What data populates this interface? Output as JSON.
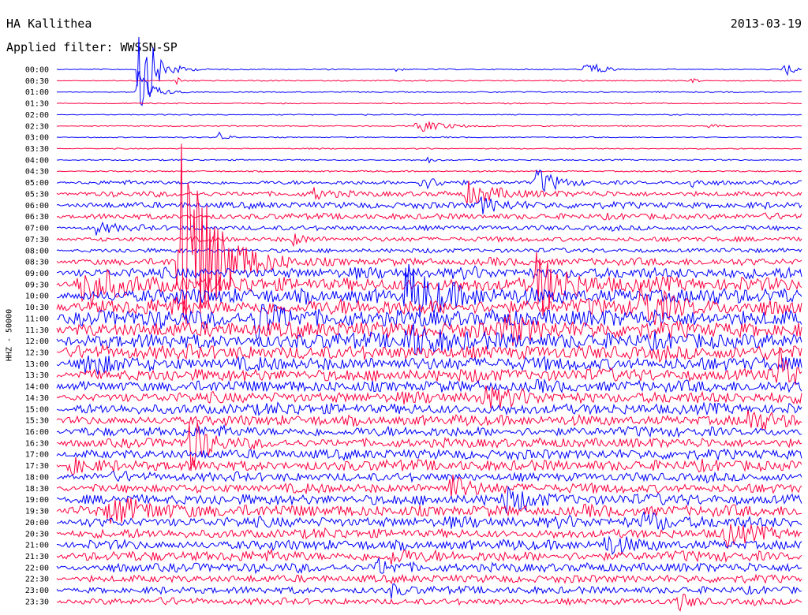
{
  "chart_data": {
    "type": "helicorder",
    "title": "HA Kallithea",
    "date": "2013-03-19",
    "subtitle": "Applied filter: WWSSN-SP",
    "ylabel": "HHZ - 50000",
    "row_labels": [
      "00:00",
      "00:30",
      "01:00",
      "01:30",
      "02:00",
      "02:30",
      "03:00",
      "03:30",
      "04:00",
      "04:30",
      "05:00",
      "05:30",
      "06:00",
      "06:30",
      "07:00",
      "07:30",
      "08:00",
      "08:30",
      "09:00",
      "09:30",
      "10:00",
      "10:30",
      "11:00",
      "11:30",
      "12:00",
      "12:30",
      "13:00",
      "13:30",
      "14:00",
      "14:30",
      "15:00",
      "15:30",
      "16:00",
      "16:30",
      "17:00",
      "17:30",
      "18:00",
      "18:30",
      "19:00",
      "19:30",
      "20:00",
      "20:30",
      "21:00",
      "21:30",
      "22:00",
      "22:30",
      "23:00",
      "23:30"
    ],
    "row_minutes": 30,
    "colors": [
      "#0000ff",
      "#ff0040"
    ],
    "noise_level": [
      0.5,
      0.5,
      0.5,
      0.5,
      0.5,
      0.5,
      0.5,
      0.5,
      0.6,
      0.7,
      1.8,
      2.5,
      3.0,
      2.6,
      2.4,
      2.2,
      2.0,
      3.5,
      5.0,
      6.5,
      7.0,
      7.5,
      8.0,
      7.5,
      7.0,
      6.8,
      6.2,
      5.8,
      5.5,
      5.2,
      5.0,
      4.8,
      4.6,
      4.5,
      4.6,
      4.8,
      4.2,
      4.4,
      5.0,
      5.4,
      5.0,
      4.2,
      4.6,
      4.8,
      4.2,
      3.6,
      3.2,
      3.0
    ],
    "events": [
      {
        "row": 0,
        "minute": 3.3,
        "amplitude": 80,
        "duration": 1.2
      },
      {
        "row": 0,
        "minute": 13.5,
        "amplitude": 8,
        "duration": 0.4
      },
      {
        "row": 0,
        "minute": 21.3,
        "amplitude": 15,
        "duration": 1.0
      },
      {
        "row": 0,
        "minute": 29.3,
        "amplitude": 18,
        "duration": 0.5
      },
      {
        "row": 1,
        "minute": 4.8,
        "amplitude": 6,
        "duration": 0.4
      },
      {
        "row": 1,
        "minute": 25.6,
        "amplitude": 5,
        "duration": 0.4
      },
      {
        "row": 2,
        "minute": 3.2,
        "amplitude": 40,
        "duration": 1.0
      },
      {
        "row": 5,
        "minute": 14.5,
        "amplitude": 10,
        "duration": 2.0
      },
      {
        "row": 5,
        "minute": 26.2,
        "amplitude": 4,
        "duration": 0.8
      },
      {
        "row": 6,
        "minute": 6.5,
        "amplitude": 8,
        "duration": 0.6
      },
      {
        "row": 8,
        "minute": 14.9,
        "amplitude": 5,
        "duration": 0.5
      },
      {
        "row": 10,
        "minute": 14.6,
        "amplitude": 8,
        "duration": 2.0
      },
      {
        "row": 10,
        "minute": 19.3,
        "amplitude": 20,
        "duration": 1.5
      },
      {
        "row": 10,
        "minute": 25.5,
        "amplitude": 8,
        "duration": 1.0
      },
      {
        "row": 11,
        "minute": 16.5,
        "amplitude": 15,
        "duration": 2.5
      },
      {
        "row": 11,
        "minute": 10.2,
        "amplitude": 8,
        "duration": 1.5
      },
      {
        "row": 12,
        "minute": 17.0,
        "amplitude": 10,
        "duration": 2.0
      },
      {
        "row": 14,
        "minute": 1.5,
        "amplitude": 8,
        "duration": 1.5
      },
      {
        "row": 15,
        "minute": 9.5,
        "amplitude": 8,
        "duration": 1.0
      },
      {
        "row": 17,
        "minute": 4.9,
        "amplitude": 200,
        "duration": 2.5
      },
      {
        "row": 19,
        "minute": 0.9,
        "amplitude": 35,
        "duration": 2.5
      },
      {
        "row": 19,
        "minute": 19.3,
        "amplitude": 45,
        "duration": 2.0
      },
      {
        "row": 20,
        "minute": 14.0,
        "amplitude": 35,
        "duration": 3.0
      },
      {
        "row": 21,
        "minute": 23.5,
        "amplitude": 30,
        "duration": 2.0
      },
      {
        "row": 22,
        "minute": 8.0,
        "amplitude": 25,
        "duration": 2.0
      },
      {
        "row": 23,
        "minute": 18.0,
        "amplitude": 20,
        "duration": 2.0
      },
      {
        "row": 24,
        "minute": 14.0,
        "amplitude": 22,
        "duration": 2.5
      },
      {
        "row": 26,
        "minute": 1.0,
        "amplitude": 18,
        "duration": 2.0
      },
      {
        "row": 27,
        "minute": 29.0,
        "amplitude": 40,
        "duration": 1.0
      },
      {
        "row": 29,
        "minute": 17.0,
        "amplitude": 15,
        "duration": 2.0
      },
      {
        "row": 31,
        "minute": 27.8,
        "amplitude": 12,
        "duration": 2.0
      },
      {
        "row": 33,
        "minute": 5.3,
        "amplitude": 45,
        "duration": 1.2
      },
      {
        "row": 35,
        "minute": 0.5,
        "amplitude": 12,
        "duration": 1.5
      },
      {
        "row": 37,
        "minute": 15.8,
        "amplitude": 18,
        "duration": 1.5
      },
      {
        "row": 38,
        "minute": 17.9,
        "amplitude": 15,
        "duration": 2.0
      },
      {
        "row": 39,
        "minute": 2.1,
        "amplitude": 15,
        "duration": 4.0
      },
      {
        "row": 40,
        "minute": 23.6,
        "amplitude": 15,
        "duration": 1.5
      },
      {
        "row": 41,
        "minute": 26.8,
        "amplitude": 18,
        "duration": 2.0
      },
      {
        "row": 42,
        "minute": 22.0,
        "amplitude": 12,
        "duration": 2.0
      },
      {
        "row": 43,
        "minute": 13.4,
        "amplitude": 10,
        "duration": 1.5
      },
      {
        "row": 44,
        "minute": 12.9,
        "amplitude": 10,
        "duration": 1.5
      },
      {
        "row": 46,
        "minute": 13.4,
        "amplitude": 8,
        "duration": 1.0
      },
      {
        "row": 47,
        "minute": 25.0,
        "amplitude": 12,
        "duration": 1.0
      }
    ]
  }
}
